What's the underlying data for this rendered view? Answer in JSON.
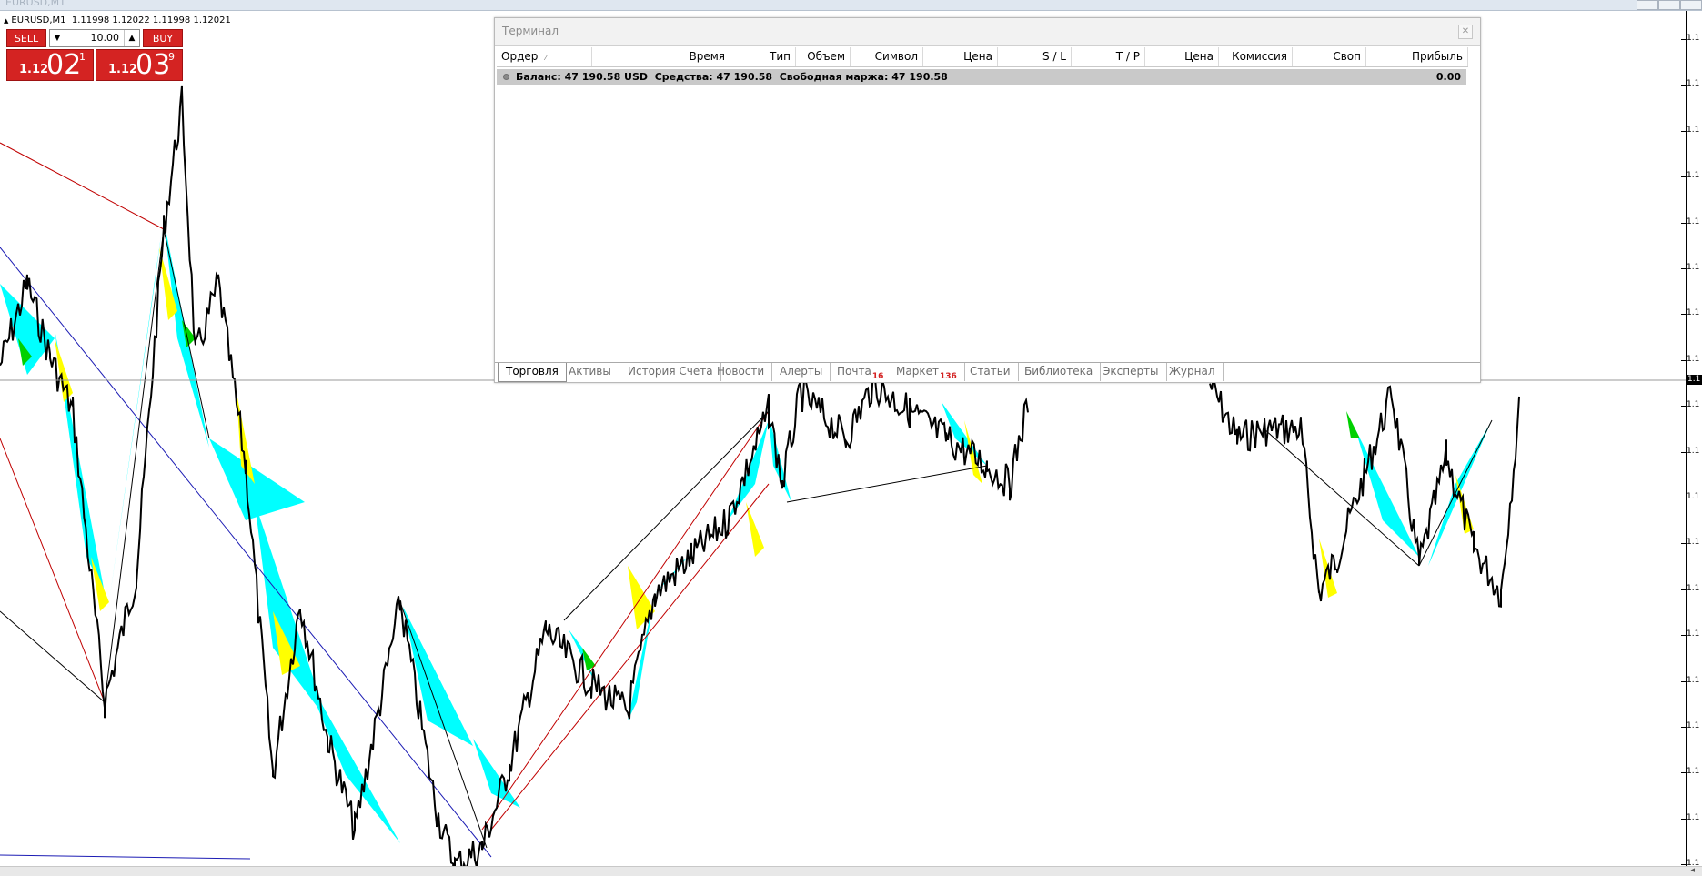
{
  "window": {
    "title": "EURUSD,M1"
  },
  "chart_header": {
    "symbol_line": "EURUSD,M1  1.11998 1.12022 1.11998 1.12021"
  },
  "one_click": {
    "sell_label": "SELL",
    "buy_label": "BUY",
    "lot_value": "10.00",
    "sell_price": {
      "prefix": "1.12",
      "big": "02",
      "sup": "1"
    },
    "buy_price": {
      "prefix": "1.12",
      "big": "03",
      "sup": "9"
    }
  },
  "price_axis": {
    "ticks": [
      "1.1",
      "1.1",
      "1.1",
      "1.1",
      "1.1",
      "1.1",
      "1.1",
      "1.1",
      "1.1",
      "1.1",
      "1.1",
      "1.1",
      "1.1",
      "1.1",
      "1.1",
      "1.1",
      "1.1",
      "1.1",
      "1.1"
    ],
    "current": "1.1"
  },
  "terminal": {
    "title": "Терминал",
    "columns": [
      "Ордер",
      "Время",
      "Тип",
      "Объем",
      "Символ",
      "Цена",
      "S / L",
      "T / P",
      "Цена",
      "Комиссия",
      "Своп",
      "Прибыль"
    ],
    "balance_text": "Баланс: 47 190.58 USD  Средства: 47 190.58  Свободная маржа: 47 190.58",
    "balance_profit": "0.00",
    "tabs": [
      {
        "label": "Торговля",
        "badge": ""
      },
      {
        "label": "Активы",
        "badge": ""
      },
      {
        "label": "История Счета",
        "badge": ""
      },
      {
        "label": "Новости",
        "badge": ""
      },
      {
        "label": "Алерты",
        "badge": ""
      },
      {
        "label": "Почта",
        "badge": "16"
      },
      {
        "label": "Маркет",
        "badge": "136"
      },
      {
        "label": "Статьи",
        "badge": ""
      },
      {
        "label": "Библиотека",
        "badge": ""
      },
      {
        "label": "Эксперты",
        "badge": ""
      },
      {
        "label": "Журнал",
        "badge": ""
      }
    ]
  },
  "colors": {
    "sell_buy_red": "#d42322",
    "cyan_fill": "#00ffff",
    "yellow_fill": "#ffff00",
    "green_fill": "#00d000",
    "red_line": "#c00000",
    "blue_line": "#1c1cb4"
  }
}
